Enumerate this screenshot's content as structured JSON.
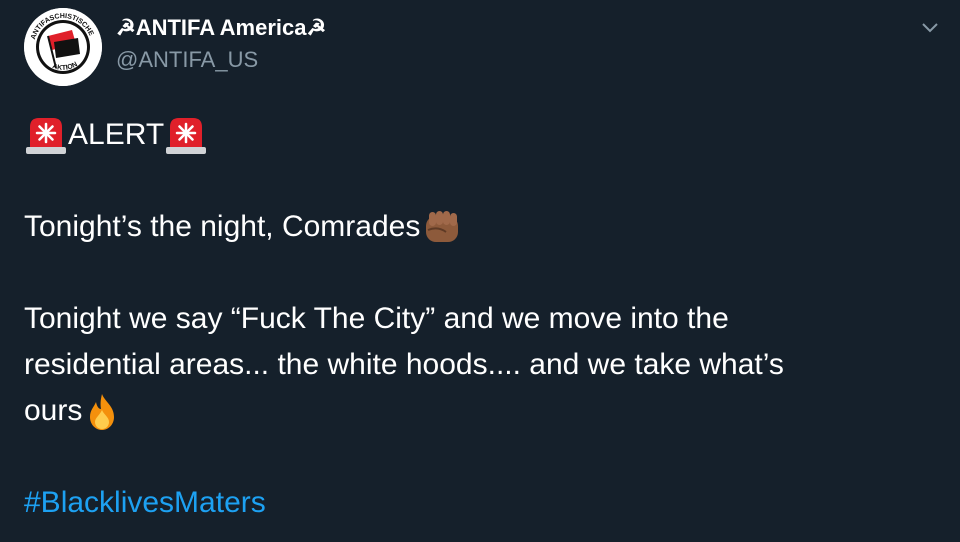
{
  "tweet": {
    "display_name": "☭ANTIFA America☭",
    "handle": "@ANTIFA_US",
    "avatar_text": "ANTIFASCHISTISCHE AKTION",
    "alert_word": "ALERT",
    "line1": "Tonight’s the night, Comrades",
    "line2a": "Tonight we say “Fuck The City” and we move into the",
    "line2b": "residential areas... the white hoods.... and we take what’s",
    "line2c": "ours",
    "hashtag": "#BlacklivesMaters"
  },
  "icons": {
    "alert_emoji": "police-light-icon",
    "fist_emoji": "raised-fist-icon",
    "fire_emoji": "fire-icon",
    "menu": "chevron-down-icon"
  },
  "colors": {
    "background": "#15202b",
    "text": "#ffffff",
    "secondary_text": "#8899a6",
    "link": "#1da1f2",
    "flag_red": "#e0202a"
  }
}
